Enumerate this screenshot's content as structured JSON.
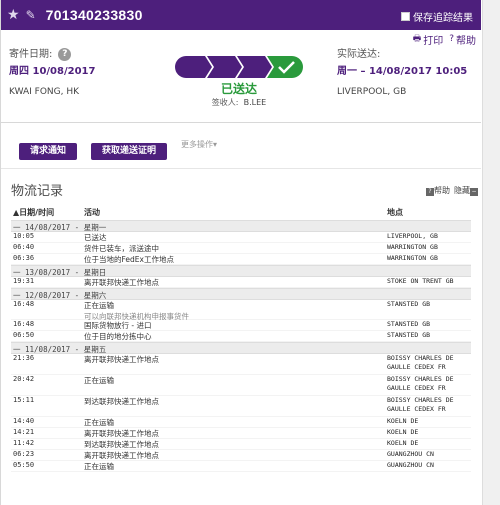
{
  "header": {
    "tracking_number": "701340233830",
    "save_label": "保存追踪结果",
    "star_icon": "star-icon",
    "edit_icon": "pencil-icon"
  },
  "links": {
    "print": "打印",
    "help": "帮助"
  },
  "shipment": {
    "ship_date_label": "寄件日期:",
    "ship_date": "周四 10/08/2017",
    "origin": "KWAI FONG, HK",
    "delivered_label": "实际送达:",
    "delivered_date": "周一 – 14/08/2017 10:05",
    "destination": "LIVERPOOL, GB",
    "status": "已送达",
    "signed_by_label": "签收人:",
    "signed_by": "B.LEE",
    "progress_steps": 4,
    "progress_completed": 4
  },
  "actions": {
    "request_notification": "请求通知",
    "get_proof": "获取递送证明",
    "more_actions": "更多操作▾"
  },
  "history": {
    "title": "物流记录",
    "help": "帮助",
    "hide": "隐藏",
    "columns": {
      "date": "▲日期/时间",
      "activity": "活动",
      "location": "地点"
    },
    "groups": [
      {
        "day": "一  14/08/2017 - 星期一",
        "events": [
          {
            "time": "10:05",
            "activity": "已送达",
            "sub": "",
            "location": "LIVERPOOL, GB"
          },
          {
            "time": "06:40",
            "activity": "货件已装车，派送途中",
            "sub": "",
            "location": "WARRINGTON GB"
          },
          {
            "time": "06:36",
            "activity": "位于当地的FedEx工作地点",
            "sub": "",
            "location": "WARRINGTON GB"
          }
        ]
      },
      {
        "day": "一  13/08/2017 - 星期日",
        "events": [
          {
            "time": "19:31",
            "activity": "离开联邦快递工作地点",
            "sub": "",
            "location": "STOKE ON TRENT GB"
          }
        ]
      },
      {
        "day": "一  12/08/2017 - 星期六",
        "events": [
          {
            "time": "16:48",
            "activity": "正在运输",
            "sub": "可以向联邦快递机构申报事货件",
            "location": "STANSTED GB"
          },
          {
            "time": "16:48",
            "activity": "国际货物放行 - 进口",
            "sub": "",
            "location": "STANSTED GB"
          },
          {
            "time": "06:50",
            "activity": "位于目的地分拣中心",
            "sub": "",
            "location": "STANSTED GB"
          }
        ]
      },
      {
        "day": "一  11/08/2017 - 星期五",
        "events": [
          {
            "time": "21:36",
            "activity": "离开联邦快递工作地点",
            "sub": "",
            "location": "BOISSY CHARLES DE\nGAULLE CEDEX FR"
          },
          {
            "time": "20:42",
            "activity": "正在运输",
            "sub": "",
            "location": "BOISSY CHARLES DE\nGAULLE CEDEX FR"
          },
          {
            "time": "15:11",
            "activity": "到达联邦快递工作地点",
            "sub": "",
            "location": "BOISSY CHARLES DE\nGAULLE CEDEX FR"
          },
          {
            "time": "14:40",
            "activity": "正在运输",
            "sub": "",
            "location": "KOELN DE"
          },
          {
            "time": "14:21",
            "activity": "离开联邦快递工作地点",
            "sub": "",
            "location": "KOELN DE"
          },
          {
            "time": "11:42",
            "activity": "到达联邦快递工作地点",
            "sub": "",
            "location": "KOELN DE"
          },
          {
            "time": "06:23",
            "activity": "离开联邦快递工作地点",
            "sub": "",
            "location": "GUANGZHOU CN"
          },
          {
            "time": "05:50",
            "activity": "正在运输",
            "sub": "",
            "location": "GUANGZHOU CN"
          }
        ]
      }
    ]
  },
  "colors": {
    "brand": "#4d1f7c",
    "delivered": "#2a9a3c"
  }
}
